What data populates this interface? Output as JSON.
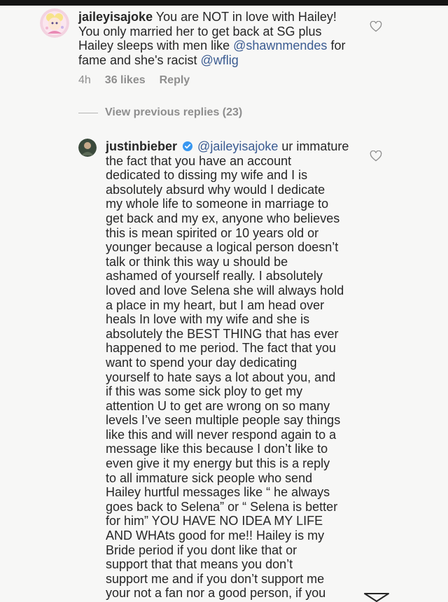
{
  "comment1": {
    "username": "jaileyisajoke",
    "lines": [
      " You are NOT in love with Hailey!",
      "You only married her to get back at SG plus",
      "Hailey sleeps with men like ",
      "fame and she's racist "
    ],
    "mention_shawn": "@shawnmendes",
    "after_shawn": " for",
    "mention_wflig": "@wflig",
    "time": "4h",
    "likes": "36 likes",
    "reply": "Reply"
  },
  "view_previous": "View previous replies (23)",
  "reply": {
    "username": "justinbieber",
    "mention": "@jaileyisajoke",
    "first_line_rest": " ur immature",
    "lines": [
      "the fact that you have an account",
      "dedicated to dissing my wife and I is",
      "absolutely absurd why would I dedicate",
      "my whole life to someone in marriage to",
      "get back and my ex, anyone who believes",
      "this is mean spirited or 10 years old or",
      "younger because a logical person doesn’t",
      "talk or think this way u should be",
      "ashamed of yourself really.  I absolutely",
      "loved and love Selena she will always hold",
      "a place in my heart, but I am head over",
      "heals In love with my wife and she is",
      "absolutely the BEST THING that has ever",
      "happened to me period. The fact that you",
      "want to spend your day dedicating",
      "yourself to hate says a lot about you, and",
      "if this was some sick ploy to get my",
      "attention U to get are wrong on so many",
      "levels I’ve seen multiple people say things",
      "like this and will never respond again to a",
      "message like this because I don’t like to",
      "even give it my energy but this is a reply",
      "to all immature sick people who send",
      "Hailey hurtful messages like “ he always",
      "goes back to Selena” or “ Selena is better",
      "for him” YOU HAVE NO IDEA MY LIFE",
      "AND WHAts good for me!! Hailey is my",
      "Bride period if you dont like that or",
      "support that that means you don’t",
      "support me and if you don’t support me",
      "your not a fan nor a good person, if you"
    ]
  },
  "colors": {
    "text": "#262626",
    "mention": "#3a5b91",
    "meta": "#8e8e8e",
    "verified": "#3897f0",
    "background": "#f7f7f6"
  },
  "icons": [
    "heart-outline-icon",
    "verified-badge-icon",
    "share-arrow-icon"
  ]
}
